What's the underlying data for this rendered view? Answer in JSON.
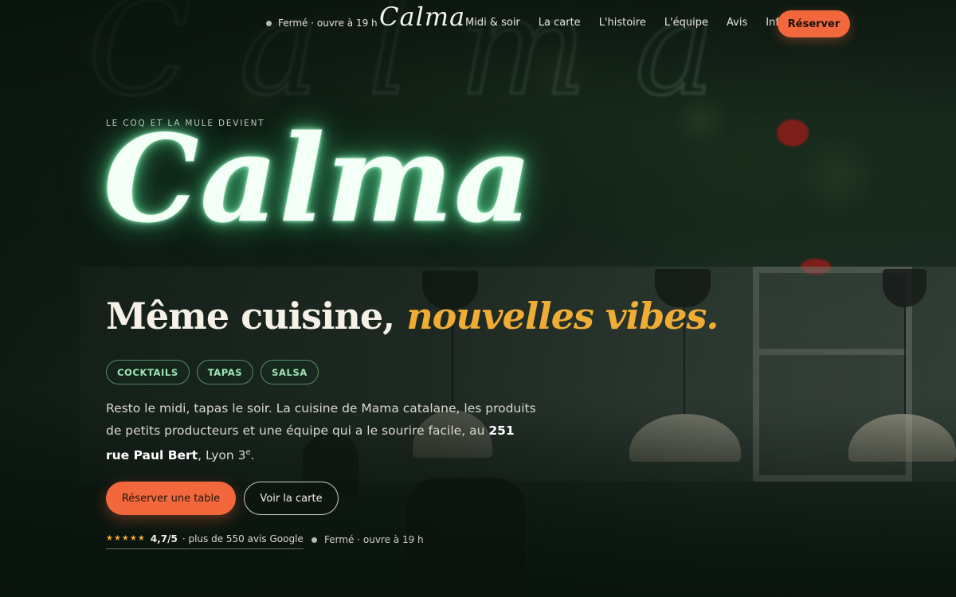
{
  "nav": {
    "status": "Fermé · ouvre à 19 h",
    "logo": "Calma",
    "links": [
      "Midi & soir",
      "La carte",
      "L'histoire",
      "L'équipe",
      "Avis",
      "Infos"
    ],
    "cta": "Réserver"
  },
  "hero": {
    "eyebrow": "LE COQ ET LA MULE DEVIENT",
    "neon_title": "Calma",
    "headline_main": "Même cuisine,",
    "headline_accent": "nouvelles vibes.",
    "tags": [
      "COCKTAILS",
      "TAPAS",
      "SALSA"
    ],
    "description": {
      "text_before": "Resto le midi, tapas le soir. La cuisine de Mama catalane, les produits de petits producteurs et une équipe qui a le sourire facile, au ",
      "address_bold": "251 rue Paul Bert",
      "text_after": ", Lyon 3",
      "superscript": "e",
      "end": "."
    },
    "primary_cta": "Réserver une table",
    "secondary_cta": "Voir la carte",
    "rating": {
      "stars": "★★★★★",
      "score": "4,7/5",
      "text": "· plus de 550 avis Google"
    },
    "status": "Fermé · ouvre à 19 h"
  },
  "colors": {
    "accent": "#f2683c",
    "gold": "#f0ad35",
    "neon": "#9de6b6",
    "background": "#0f1a14"
  },
  "icons": {
    "status_dot": "status-dot-icon",
    "stars": "star-icon"
  }
}
